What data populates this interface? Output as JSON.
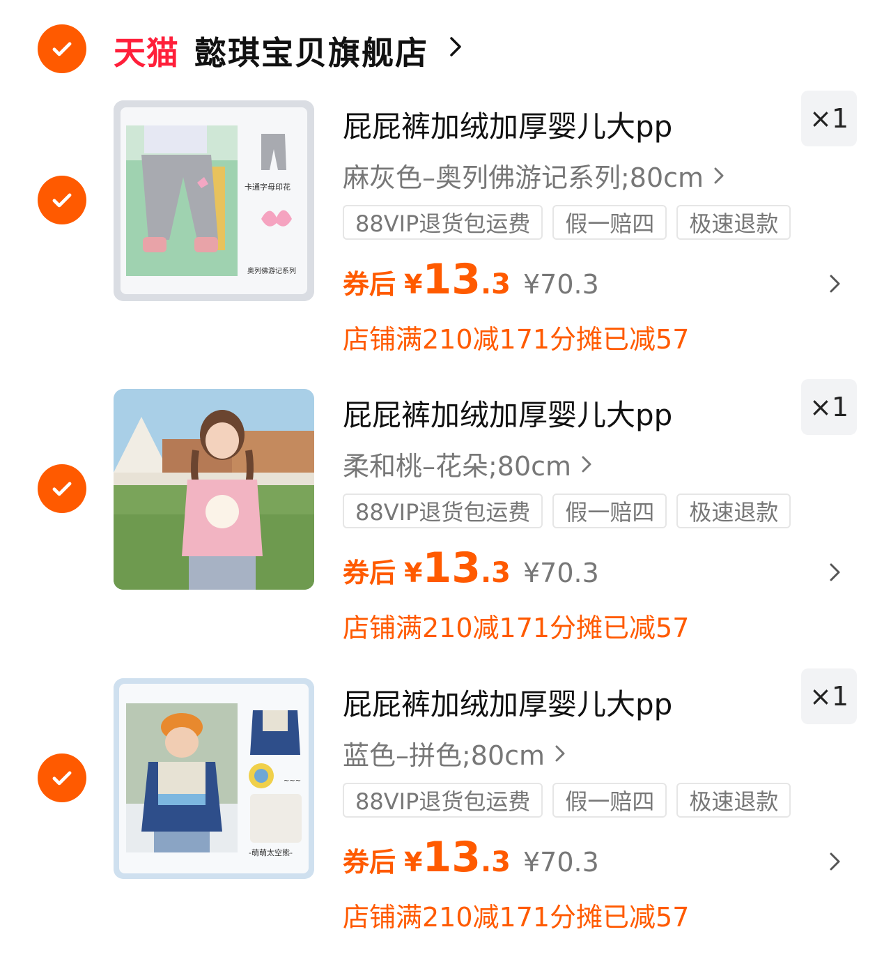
{
  "store": {
    "brand": "天猫",
    "name": "懿琪宝贝旗舰店"
  },
  "items": [
    {
      "title": "屁屁裤加绒加厚婴儿大pp",
      "quantity": "×1",
      "spec": "麻灰色–奥列佛游记系列;80cm",
      "tags": [
        "88VIP退货包运费",
        "假一赔四",
        "极速退款"
      ],
      "price_prefix": "券后",
      "currency": "¥",
      "price_int": "13",
      "price_dec": ".3",
      "original_price": "¥70.3",
      "promo": "店铺满210减171分摊已减57",
      "image_labels": [
        "卡通字母印花",
        "奥列佛游记系列"
      ]
    },
    {
      "title": "屁屁裤加绒加厚婴儿大pp",
      "quantity": "×1",
      "spec": "柔和桃–花朵;80cm",
      "tags": [
        "88VIP退货包运费",
        "假一赔四",
        "极速退款"
      ],
      "price_prefix": "券后",
      "currency": "¥",
      "price_int": "13",
      "price_dec": ".3",
      "original_price": "¥70.3",
      "promo": "店铺满210减171分摊已减57"
    },
    {
      "title": "屁屁裤加绒加厚婴儿大pp",
      "quantity": "×1",
      "spec": "蓝色–拼色;80cm",
      "tags": [
        "88VIP退货包运费",
        "假一赔四",
        "极速退款"
      ],
      "price_prefix": "券后",
      "currency": "¥",
      "price_int": "13",
      "price_dec": ".3",
      "original_price": "¥70.3",
      "promo": "店铺满210减171分摊已减57",
      "image_labels": [
        "-萌萌太空熊-"
      ]
    }
  ],
  "colors": {
    "accent": "#ff5a00",
    "brand_red": "#ff1f3a",
    "muted_text": "#777777",
    "qty_bg": "#f2f3f5"
  },
  "icons": {
    "check": "check-circle-icon",
    "chevron": "chevron-right-icon"
  }
}
